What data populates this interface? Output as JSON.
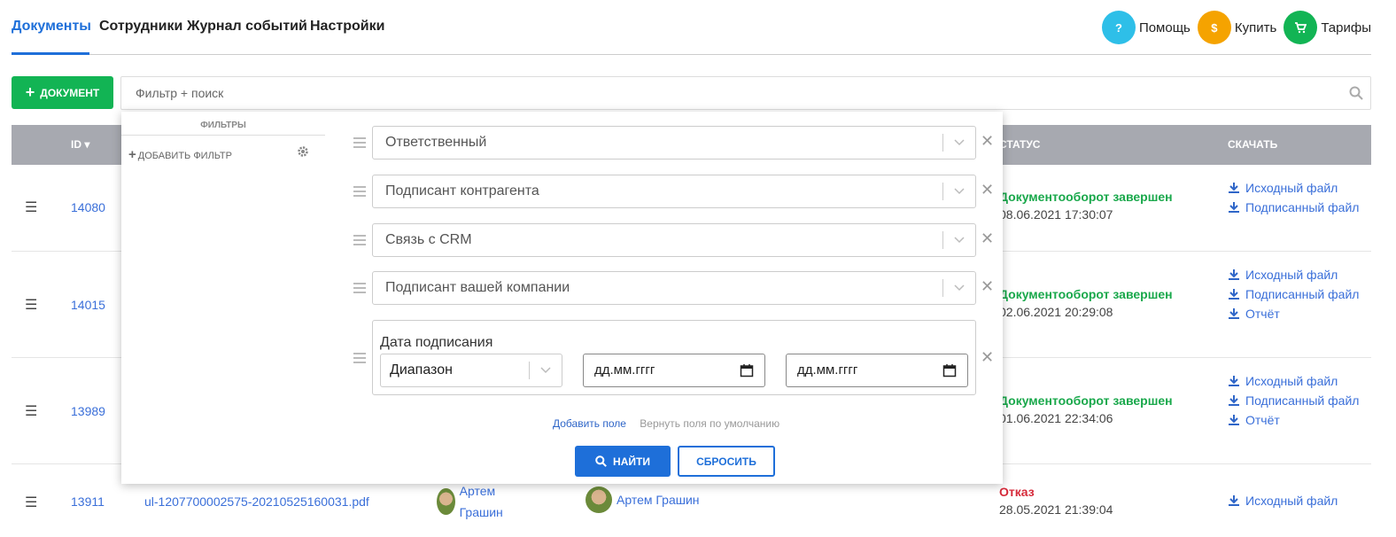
{
  "nav": {
    "tabs": [
      {
        "label": "Документы"
      },
      {
        "label": "Сотрудники"
      },
      {
        "label": "Журнал событий"
      },
      {
        "label": "Настройки"
      }
    ],
    "actions": [
      {
        "label": "Помощь",
        "icon": "?",
        "color": "#2ebfe8"
      },
      {
        "label": "Купить",
        "icon": "$",
        "color": "#f5a300"
      },
      {
        "label": "Тарифы",
        "icon": "cart-icon",
        "color": "#12b454"
      }
    ]
  },
  "toolbar": {
    "add_document_label": "ДОКУМЕНТ",
    "search_placeholder": "Фильтр + поиск"
  },
  "table": {
    "headers": {
      "id": "ID",
      "status": "Статус",
      "download": "Скачать"
    },
    "rows": [
      {
        "id": "14080",
        "status": "Документооборот завершен",
        "time": "08.06.2021 17:30:07",
        "downloads": [
          "Исходный файл",
          "Подписанный файл"
        ]
      },
      {
        "id": "14015",
        "status": "Документооборот завершен",
        "time": "02.06.2021 20:29:08",
        "downloads": [
          "Исходный файл",
          "Подписанный файл",
          "Отчёт"
        ]
      },
      {
        "id": "13989",
        "status": "Документооборот завершен",
        "time": "01.06.2021 22:34:06",
        "downloads": [
          "Исходный файл",
          "Подписанный файл",
          "Отчёт"
        ]
      },
      {
        "id": "13911",
        "file": "ul-1207700002575-20210525160031.pdf",
        "person1": "Артем Грашин",
        "person2": "Артем Грашин",
        "status": "Отказ",
        "time": "28.05.2021 21:39:04",
        "downloads": [
          "Исходный файл"
        ]
      }
    ]
  },
  "filter_panel": {
    "title": "ФИЛЬТРЫ",
    "add_filter": "ДОБАВИТЬ ФИЛЬТР",
    "fields": [
      "Ответственный",
      "Подписант контрагента",
      "Связь с CRM",
      "Подписант вашей компании"
    ],
    "date": {
      "label": "Дата подписания",
      "mode": "Диапазон",
      "from_placeholder": "дд.мм.гггг",
      "to_placeholder": "дд.мм.гггг"
    },
    "add_field": "Добавить поле",
    "reset_fields": "Вернуть поля по умолчанию",
    "find_label": "НАЙТИ",
    "reset_label": "СБРОСИТЬ"
  }
}
